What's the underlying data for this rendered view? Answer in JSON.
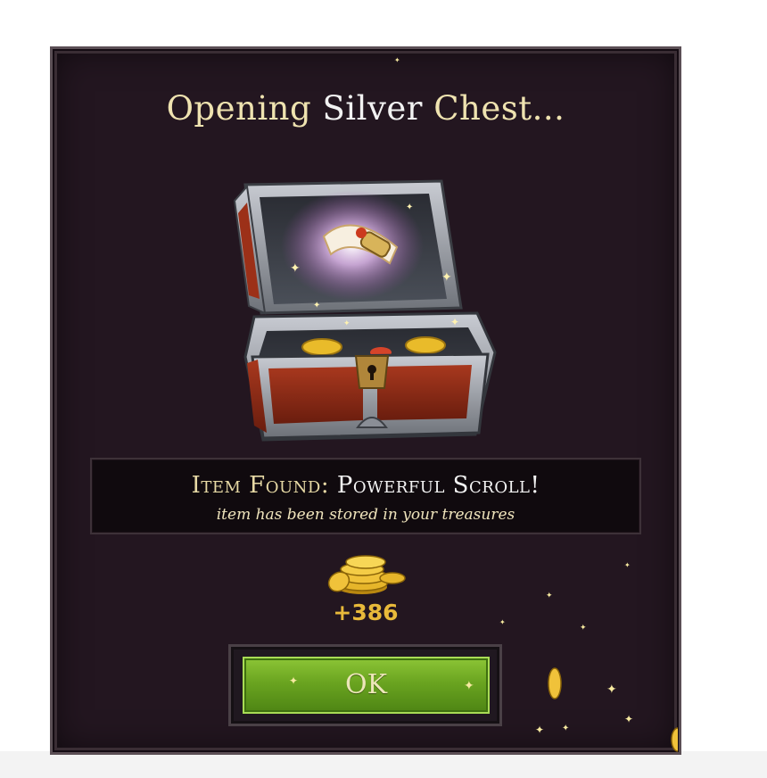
{
  "dialog": {
    "title_prefix": "Opening",
    "title_chest": "Silver",
    "title_suffix": "Chest...",
    "banner": {
      "label": "Item Found:",
      "item_name": "Powerful Scroll!",
      "subtitle": "item has been stored in your treasures"
    },
    "reward_amount": "+386",
    "ok_label": "OK"
  },
  "icons": [
    "treasure-chest-icon",
    "scroll-icon",
    "gold-coins-icon",
    "sparkle-icon"
  ],
  "colors": {
    "panel_bg": "#231620",
    "title_gold": "#efe3b0",
    "reward_gold": "#e8b93a",
    "button_green": "#6aa420"
  }
}
